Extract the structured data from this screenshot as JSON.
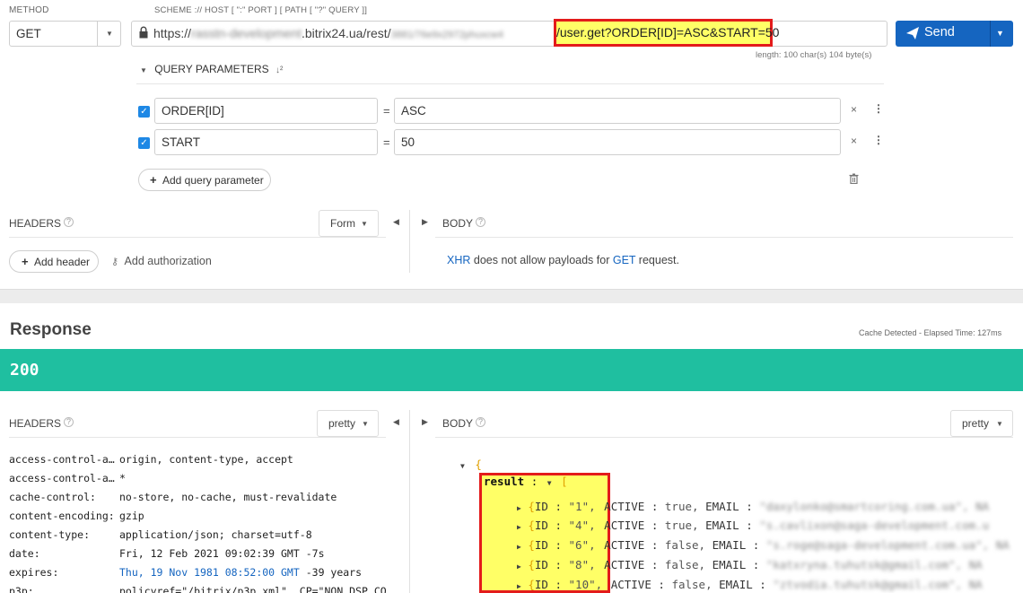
{
  "request": {
    "method_label": "METHOD",
    "method_value": "GET",
    "scheme_label": "SCHEME :// HOST [ \":\" PORT ] [ PATH [ \"?\" QUERY ]]",
    "url_prefix": "https://",
    "url_host_blur": "rasstn-development",
    "url_host": ".bitrix24.ua/rest/",
    "url_token_blur": "3881/76e9x2972phuxcw4",
    "url_highlight": "/user.get?ORDER[ID]=ASC&START=50",
    "length_info": "length: 100 char(s) 104 byte(s)",
    "send_label": "Send"
  },
  "query": {
    "section_label": "QUERY PARAMETERS",
    "params": [
      {
        "name": "ORDER[ID]",
        "value": "ASC"
      },
      {
        "name": "START",
        "value": "50"
      }
    ],
    "equals": "=",
    "add_label": "Add query parameter"
  },
  "headers_section": {
    "label": "HEADERS",
    "format": "Form",
    "add_header": "Add header",
    "add_auth": "Add authorization"
  },
  "body_section": {
    "label": "BODY",
    "msg_xhr": "XHR",
    "msg_mid": " does not allow payloads for ",
    "msg_get": "GET",
    "msg_end": " request."
  },
  "response": {
    "title": "Response",
    "cache_info": "Cache Detected - Elapsed Time: 127ms",
    "status": "200",
    "status_color": "#1fbfa0",
    "headers_label": "HEADERS",
    "body_label": "BODY",
    "pretty": "pretty",
    "headers": [
      {
        "k": "access-control-al…",
        "v": "origin, content-type, accept",
        "extra": ""
      },
      {
        "k": "access-control-al…",
        "v": "*",
        "extra": ""
      },
      {
        "k": "cache-control:",
        "v": "no-store, no-cache, must-revalidate",
        "extra": ""
      },
      {
        "k": "content-encoding:",
        "v": "gzip",
        "extra": ""
      },
      {
        "k": "content-type:",
        "v": "application/json; charset=utf-8",
        "extra": ""
      },
      {
        "k": "date:",
        "v": "Fri, 12 Feb 2021 09:02:39 GMT",
        "extra": " -7s"
      },
      {
        "k": "expires:",
        "v": "Thu, 19 Nov 1981 08:52:00 GMT",
        "extra": " -39 years"
      },
      {
        "k": "p3p:",
        "v": "policyref=\"/bitrix/p3p.xml\", CP=\"NON DSP CO",
        "extra": ""
      }
    ],
    "json": {
      "open": "{",
      "result_key": "result",
      "colon": ":",
      "arr_open": "[",
      "rows": [
        {
          "id": "\"1\"",
          "active": "true",
          "email_blur": "\"daxylonko@smartcoring.com.ua\", NA"
        },
        {
          "id": "\"4\"",
          "active": "true",
          "email_blur": "\"s.cavlixon@saga-development.com.u"
        },
        {
          "id": "\"6\"",
          "active": "false",
          "email_blur": "\"s.roge@saga-development.com.ua\", NA"
        },
        {
          "id": "\"8\"",
          "active": "false",
          "email_blur": "\"katxryna.tuhutsk@gmail.com\", NA"
        },
        {
          "id": "\"10\"",
          "active": "false",
          "email_blur": "\"ztvodia.tuhutsk@gmail.com\", NA"
        }
      ]
    }
  }
}
